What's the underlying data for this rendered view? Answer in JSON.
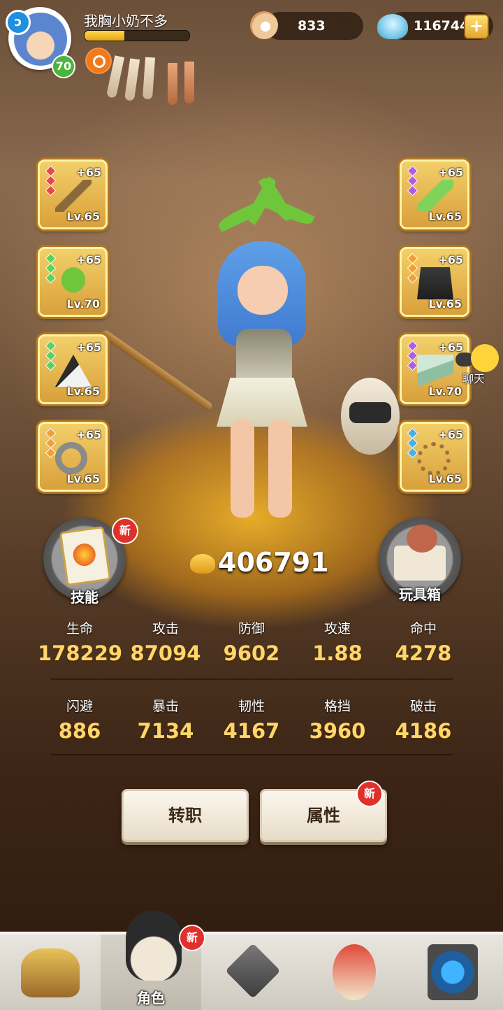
{
  "player": {
    "name": "我胸小奶不多",
    "level": "70",
    "xp_fraction": 0.38
  },
  "currency": {
    "pearl": "833",
    "shell": "116744",
    "plus": "+"
  },
  "equipment_left": [
    {
      "plus": "+65",
      "level": "Lv.65",
      "icon": "wooden-staff-icon"
    },
    {
      "plus": "+65",
      "level": "Lv.70",
      "icon": "leaf-sprout-icon"
    },
    {
      "plus": "+65",
      "level": "Lv.65",
      "icon": "fang-armor-icon"
    },
    {
      "plus": "+65",
      "level": "Lv.65",
      "icon": "stone-ring-icon"
    }
  ],
  "equipment_right": [
    {
      "plus": "+65",
      "level": "Lv.65",
      "icon": "feather-icon"
    },
    {
      "plus": "+65",
      "level": "Lv.65",
      "icon": "fur-skirt-icon"
    },
    {
      "plus": "+65",
      "level": "Lv.70",
      "icon": "bandage-boots-icon"
    },
    {
      "plus": "+65",
      "level": "Lv.65",
      "icon": "bead-necklace-icon"
    }
  ],
  "side_buttons": {
    "skill": "技能",
    "toybox": "玩具箱",
    "new_badge": "新"
  },
  "chat": "聊天",
  "power": "406791",
  "stats_row1": [
    {
      "name": "生命",
      "value": "178229"
    },
    {
      "name": "攻击",
      "value": "87094"
    },
    {
      "name": "防御",
      "value": "9602"
    },
    {
      "name": "攻速",
      "value": "1.88"
    },
    {
      "name": "命中",
      "value": "4278"
    }
  ],
  "stats_row2": [
    {
      "name": "闪避",
      "value": "886"
    },
    {
      "name": "暴击",
      "value": "7134"
    },
    {
      "name": "韧性",
      "value": "4167"
    },
    {
      "name": "格挡",
      "value": "3960"
    },
    {
      "name": "破击",
      "value": "4186"
    }
  ],
  "actions": {
    "transfer": "转职",
    "attributes": "属性"
  },
  "nav": {
    "role": "角色",
    "new_badge": "新"
  },
  "colors": {
    "slot_gold": "#e7b84e",
    "stat_value": "#ffd66a",
    "new_badge": "#e0302a"
  }
}
